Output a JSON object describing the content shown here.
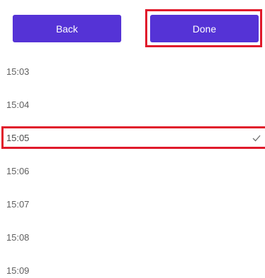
{
  "buttons": {
    "back_label": "Back",
    "done_label": "Done"
  },
  "time_list": {
    "items": [
      "15:03",
      "15:04",
      "15:05",
      "15:06",
      "15:07",
      "15:08",
      "15:09"
    ],
    "selected": "15:05"
  },
  "icons": {
    "selected_indicator": "check-icon"
  },
  "colors": {
    "button_bg": "#5533d6",
    "button_text": "#ffffff",
    "highlight": "#e01a2b",
    "item_text": "#5f5f5f"
  }
}
